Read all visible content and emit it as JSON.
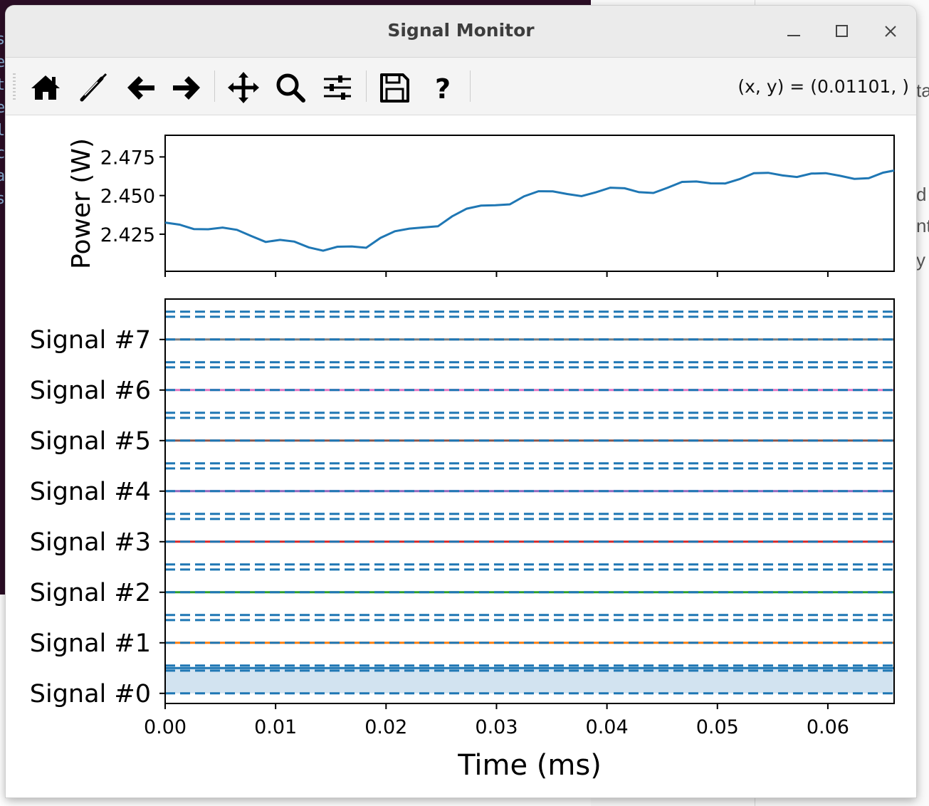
{
  "window": {
    "title": "Signal Monitor"
  },
  "toolbar": {
    "coords_text": "(x, y) = (0.01101, )",
    "tools": [
      "home-icon",
      "pencil-icon",
      "back-arrow-icon",
      "forward-arrow-icon",
      "pan-icon",
      "zoom-icon",
      "sliders-icon",
      "save-icon",
      "help-icon"
    ]
  },
  "background": {
    "right_fragments": [
      "ta",
      "d",
      "nt",
      "y"
    ]
  },
  "chart_data": [
    {
      "type": "line",
      "title": "",
      "xlabel": "",
      "ylabel": "Power (W)",
      "xlim": [
        0.0,
        0.066
      ],
      "ylim": [
        2.401,
        2.489
      ],
      "yticks": [
        "2.425",
        "2.450",
        "2.475"
      ],
      "yticks_values": [
        2.425,
        2.45,
        2.475
      ],
      "xticks_values": [
        0.0,
        0.01,
        0.02,
        0.03,
        0.04,
        0.05,
        0.06
      ],
      "x": [
        0.0,
        0.0013,
        0.0026,
        0.0039,
        0.0052,
        0.0065,
        0.0078,
        0.0091,
        0.0104,
        0.0117,
        0.013,
        0.0143,
        0.0156,
        0.0169,
        0.0182,
        0.0195,
        0.0208,
        0.0221,
        0.0234,
        0.0247,
        0.026,
        0.0273,
        0.0286,
        0.0299,
        0.0312,
        0.0325,
        0.0338,
        0.0351,
        0.0364,
        0.0377,
        0.039,
        0.0403,
        0.0416,
        0.0429,
        0.0442,
        0.0455,
        0.0468,
        0.0481,
        0.0494,
        0.0507,
        0.052,
        0.0533,
        0.0546,
        0.0559,
        0.0572,
        0.0585,
        0.0598,
        0.0611,
        0.0624,
        0.0637,
        0.065,
        0.066
      ],
      "series": [
        {
          "color": "#1f77b4",
          "values": [
            2.4325,
            2.4312,
            2.4283,
            2.4282,
            2.4293,
            2.4278,
            2.4238,
            2.42,
            2.4213,
            2.4202,
            2.4165,
            2.4143,
            2.4169,
            2.4171,
            2.4162,
            2.4226,
            2.4269,
            2.4286,
            2.4294,
            2.4301,
            2.4366,
            2.4415,
            2.4435,
            2.4437,
            2.4443,
            2.4495,
            2.4528,
            2.4527,
            2.451,
            2.4496,
            2.4521,
            2.4551,
            2.4547,
            2.4522,
            2.4517,
            2.4551,
            2.4588,
            2.4591,
            2.4579,
            2.4578,
            2.4606,
            2.4645,
            2.4647,
            2.463,
            2.462,
            2.4642,
            2.4645,
            2.4628,
            2.4608,
            2.4612,
            2.4648,
            2.4662
          ]
        }
      ]
    },
    {
      "type": "line",
      "title": "",
      "xlabel": "Time (ms)",
      "ylabel": "",
      "xlim": [
        0.0,
        0.066
      ],
      "xticks": [
        "0.00",
        "0.01",
        "0.02",
        "0.03",
        "0.04",
        "0.05",
        "0.06"
      ],
      "xticks_values": [
        0.0,
        0.01,
        0.02,
        0.03,
        0.04,
        0.05,
        0.06
      ],
      "ylim": [
        -0.2,
        7.8
      ],
      "yticks": [
        "Signal #0",
        "Signal #1",
        "Signal #2",
        "Signal #3",
        "Signal #4",
        "Signal #5",
        "Signal #6",
        "Signal #7"
      ],
      "yticks_values": [
        0,
        1,
        2,
        3,
        4,
        5,
        6,
        7
      ],
      "threshold_lines": [
        0.0,
        0.45,
        0.55,
        1.0,
        1.45,
        1.55,
        2.0,
        2.45,
        2.55,
        3.0,
        3.45,
        3.55,
        4.0,
        4.45,
        4.55,
        5.0,
        5.45,
        5.55,
        6.0,
        6.45,
        6.55,
        7.0,
        7.45,
        7.55
      ],
      "threshold_color": "#1f77b4",
      "series": [
        {
          "name": "Signal #0",
          "color": "#1f77b4",
          "level": 0,
          "value": 0.5,
          "fill": "#d2e3f0"
        },
        {
          "name": "Signal #1",
          "color": "#ff7f0e",
          "level": 1,
          "value": 0
        },
        {
          "name": "Signal #2",
          "color": "#2ca02c",
          "level": 2,
          "value": 0
        },
        {
          "name": "Signal #3",
          "color": "#d62728",
          "level": 3,
          "value": 0
        },
        {
          "name": "Signal #4",
          "color": "#9467bd",
          "level": 4,
          "value": 0
        },
        {
          "name": "Signal #5",
          "color": "#8c564b",
          "level": 5,
          "value": 0
        },
        {
          "name": "Signal #6",
          "color": "#e377c2",
          "level": 6,
          "value": 0
        },
        {
          "name": "Signal #7",
          "color": "#7f7f7f",
          "level": 7,
          "value": 0
        }
      ]
    }
  ]
}
